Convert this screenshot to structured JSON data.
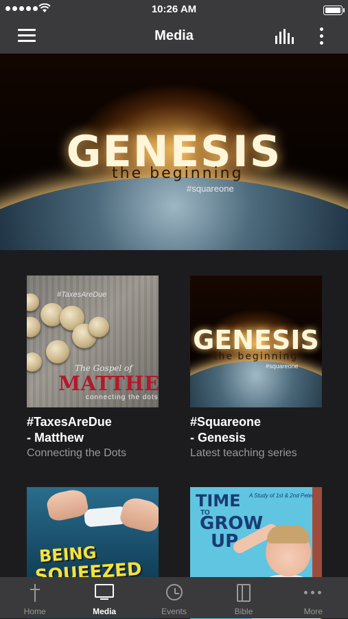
{
  "status_bar": {
    "time": "10:26 AM"
  },
  "navbar": {
    "title": "Media"
  },
  "hero": {
    "title": "GENESIS",
    "subtitle": "the beginning",
    "tag": "#squareone",
    "pages": 4,
    "active_page": 1
  },
  "cards": [
    {
      "title_line1": "#TaxesAreDue",
      "title_line2": "- Matthew",
      "description": "Connecting the Dots",
      "art": {
        "hashtag": "#TaxesAreDue",
        "gospel": "The Gospel of",
        "word": "MATTHEW",
        "tagline": "connecting the dots"
      }
    },
    {
      "title_line1": "#Squareone",
      "title_line2": "- Genesis",
      "description": "Latest teaching series",
      "art": {
        "word": "GENESIS",
        "subtitle": "the beginning",
        "tag": "#squareone"
      }
    },
    {
      "art": {
        "word1": "BEING",
        "word2": "SQUEEZED"
      }
    },
    {
      "art": {
        "line1": "TIME",
        "to": "TO",
        "line2": "GROW",
        "line3": "UP",
        "study": "A Study of 1st & 2nd Peter"
      }
    }
  ],
  "tabbar": {
    "tabs": [
      {
        "label": "Home",
        "icon": "cross-icon"
      },
      {
        "label": "Media",
        "icon": "tv-icon"
      },
      {
        "label": "Events",
        "icon": "clock-icon"
      },
      {
        "label": "Bible",
        "icon": "book-icon"
      },
      {
        "label": "More",
        "icon": "more-dots-icon"
      }
    ],
    "active": "Media"
  },
  "colors": {
    "bar": "#3a3a3c",
    "background": "#1c1c1e",
    "muted_text": "#9a9a9a"
  }
}
